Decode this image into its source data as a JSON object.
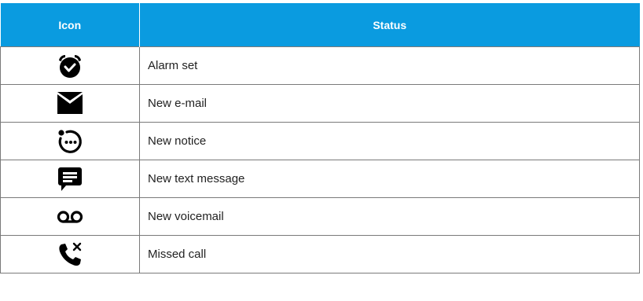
{
  "table": {
    "header_color": "#0a9be0",
    "columns": [
      "Icon",
      "Status"
    ],
    "rows": [
      {
        "icon": "alarm-clock-icon",
        "status": "Alarm set"
      },
      {
        "icon": "email-envelope-icon",
        "status": "New e-mail"
      },
      {
        "icon": "notice-dots-icon",
        "status": "New notice"
      },
      {
        "icon": "text-message-icon",
        "status": "New text message"
      },
      {
        "icon": "voicemail-icon",
        "status": "New voicemail"
      },
      {
        "icon": "missed-call-icon",
        "status": "Missed call"
      }
    ]
  }
}
